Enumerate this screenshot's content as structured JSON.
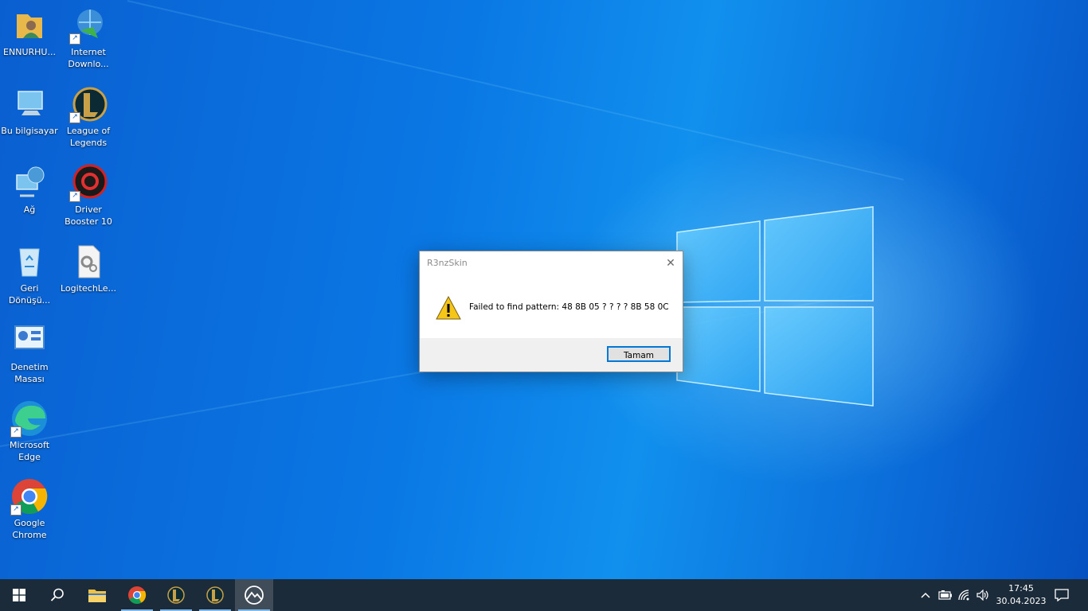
{
  "desktop": {
    "icons": [
      {
        "label": "ENNURHU..."
      },
      {
        "label": "Internet Downlo..."
      },
      {
        "label": "Bu bilgisayar"
      },
      {
        "label": "League of Legends"
      },
      {
        "label": "Ağ"
      },
      {
        "label": "Driver Booster 10"
      },
      {
        "label": "Geri Dönüşü..."
      },
      {
        "label": "LogitechLe..."
      },
      {
        "label": "Denetim Masası"
      },
      {
        "label": "Microsoft Edge"
      },
      {
        "label": "Google Chrome"
      }
    ]
  },
  "dialog": {
    "title": "R3nzSkin",
    "message": "Failed to find pattern: 48 8B 05 ? ? ? ? 8B 58 0C",
    "ok_label": "Tamam",
    "close_glyph": "✕"
  },
  "taskbar": {
    "items": [
      "windows-start",
      "search",
      "file-explorer",
      "google-chrome",
      "league-of-legends",
      "league-of-legends-client",
      "r3nzskin"
    ],
    "tray": {
      "chevron": "^",
      "time": "17:45",
      "date": "30.04.2023"
    }
  },
  "colors": {
    "desktop_blue": "#0a78e4",
    "taskbar": "#1c2b3a",
    "accent": "#0078d7"
  }
}
